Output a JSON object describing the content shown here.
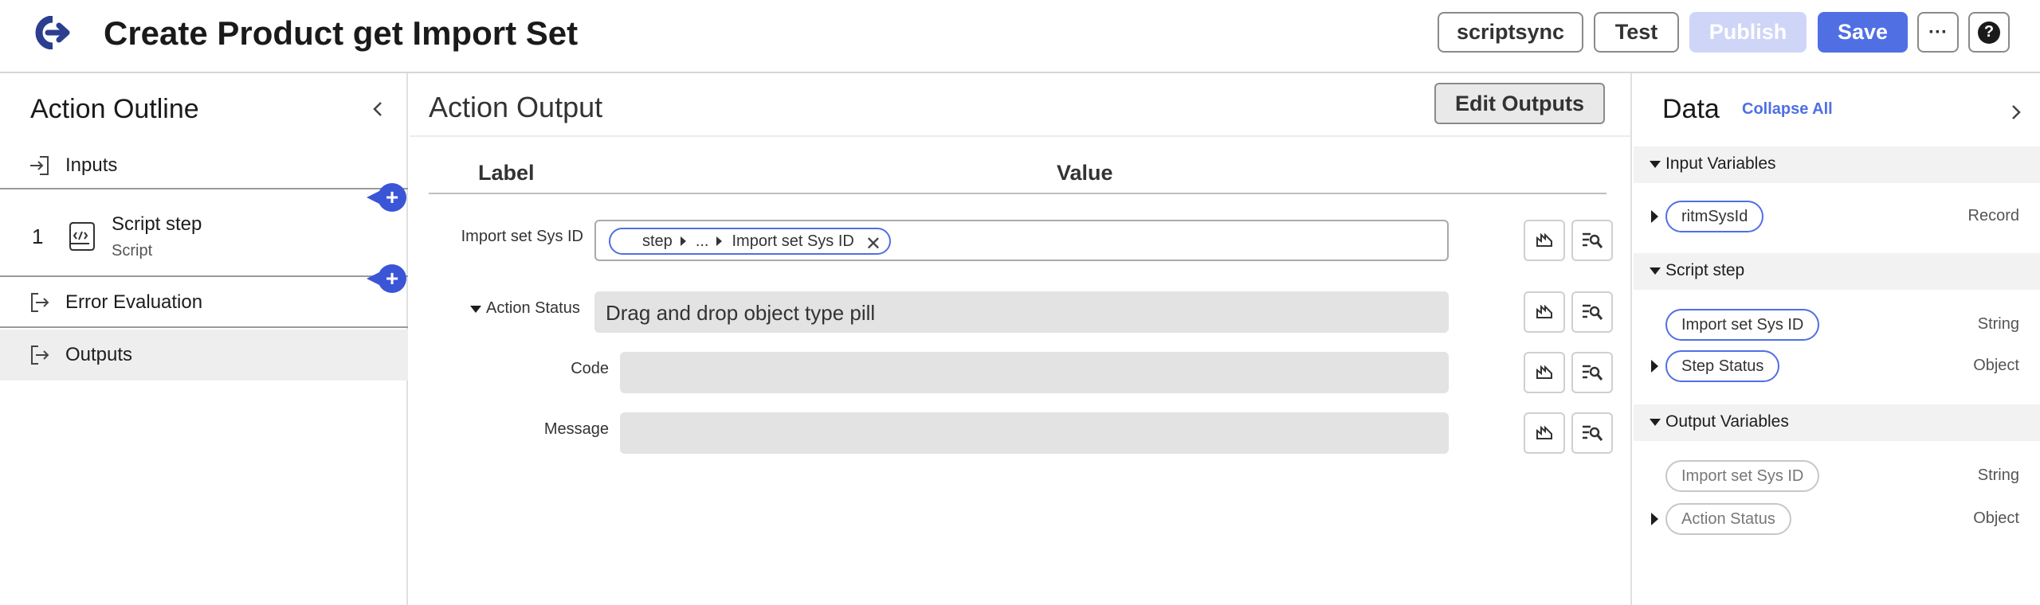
{
  "header": {
    "title": "Create Product get Import Set",
    "buttons": {
      "scriptsync": "scriptsync",
      "test": "Test",
      "publish": "Publish",
      "save": "Save",
      "more": "···",
      "help": "?"
    }
  },
  "outline": {
    "title": "Action Outline",
    "items": [
      {
        "label": "Inputs"
      },
      {
        "number": "1",
        "label": "Script step",
        "sublabel": "Script"
      },
      {
        "label": "Error Evaluation"
      },
      {
        "label": "Outputs"
      }
    ],
    "add_symbol": "+"
  },
  "output": {
    "title": "Action Output",
    "edit_button": "Edit Outputs",
    "columns": {
      "label": "Label",
      "value": "Value"
    },
    "rows": [
      {
        "label": "Import set Sys ID",
        "pill": {
          "start": "step",
          "middle": "...",
          "end": "Import set Sys ID",
          "remove": "✕"
        }
      },
      {
        "label": "Action Status",
        "value": "Drag and drop object type pill"
      },
      {
        "label": "Code",
        "value": ""
      },
      {
        "label": "Message",
        "value": ""
      }
    ]
  },
  "data_panel": {
    "title": "Data",
    "collapse_all": "Collapse All",
    "sections": [
      {
        "name": "Input Variables",
        "vars": [
          {
            "name": "ritmSysId",
            "type": "Record"
          }
        ]
      },
      {
        "name": "Script step",
        "vars": [
          {
            "name": "Import set Sys ID",
            "type": "String"
          },
          {
            "name": "Step Status",
            "type": "Object"
          }
        ]
      },
      {
        "name": "Output Variables",
        "vars": [
          {
            "name": "Import set Sys ID",
            "type": "String"
          },
          {
            "name": "Action Status",
            "type": "Object"
          }
        ]
      }
    ]
  },
  "colors": {
    "accent": "#4f6fe3",
    "add_button": "#3a55d6",
    "publish_disabled": "#cfd5f7"
  }
}
